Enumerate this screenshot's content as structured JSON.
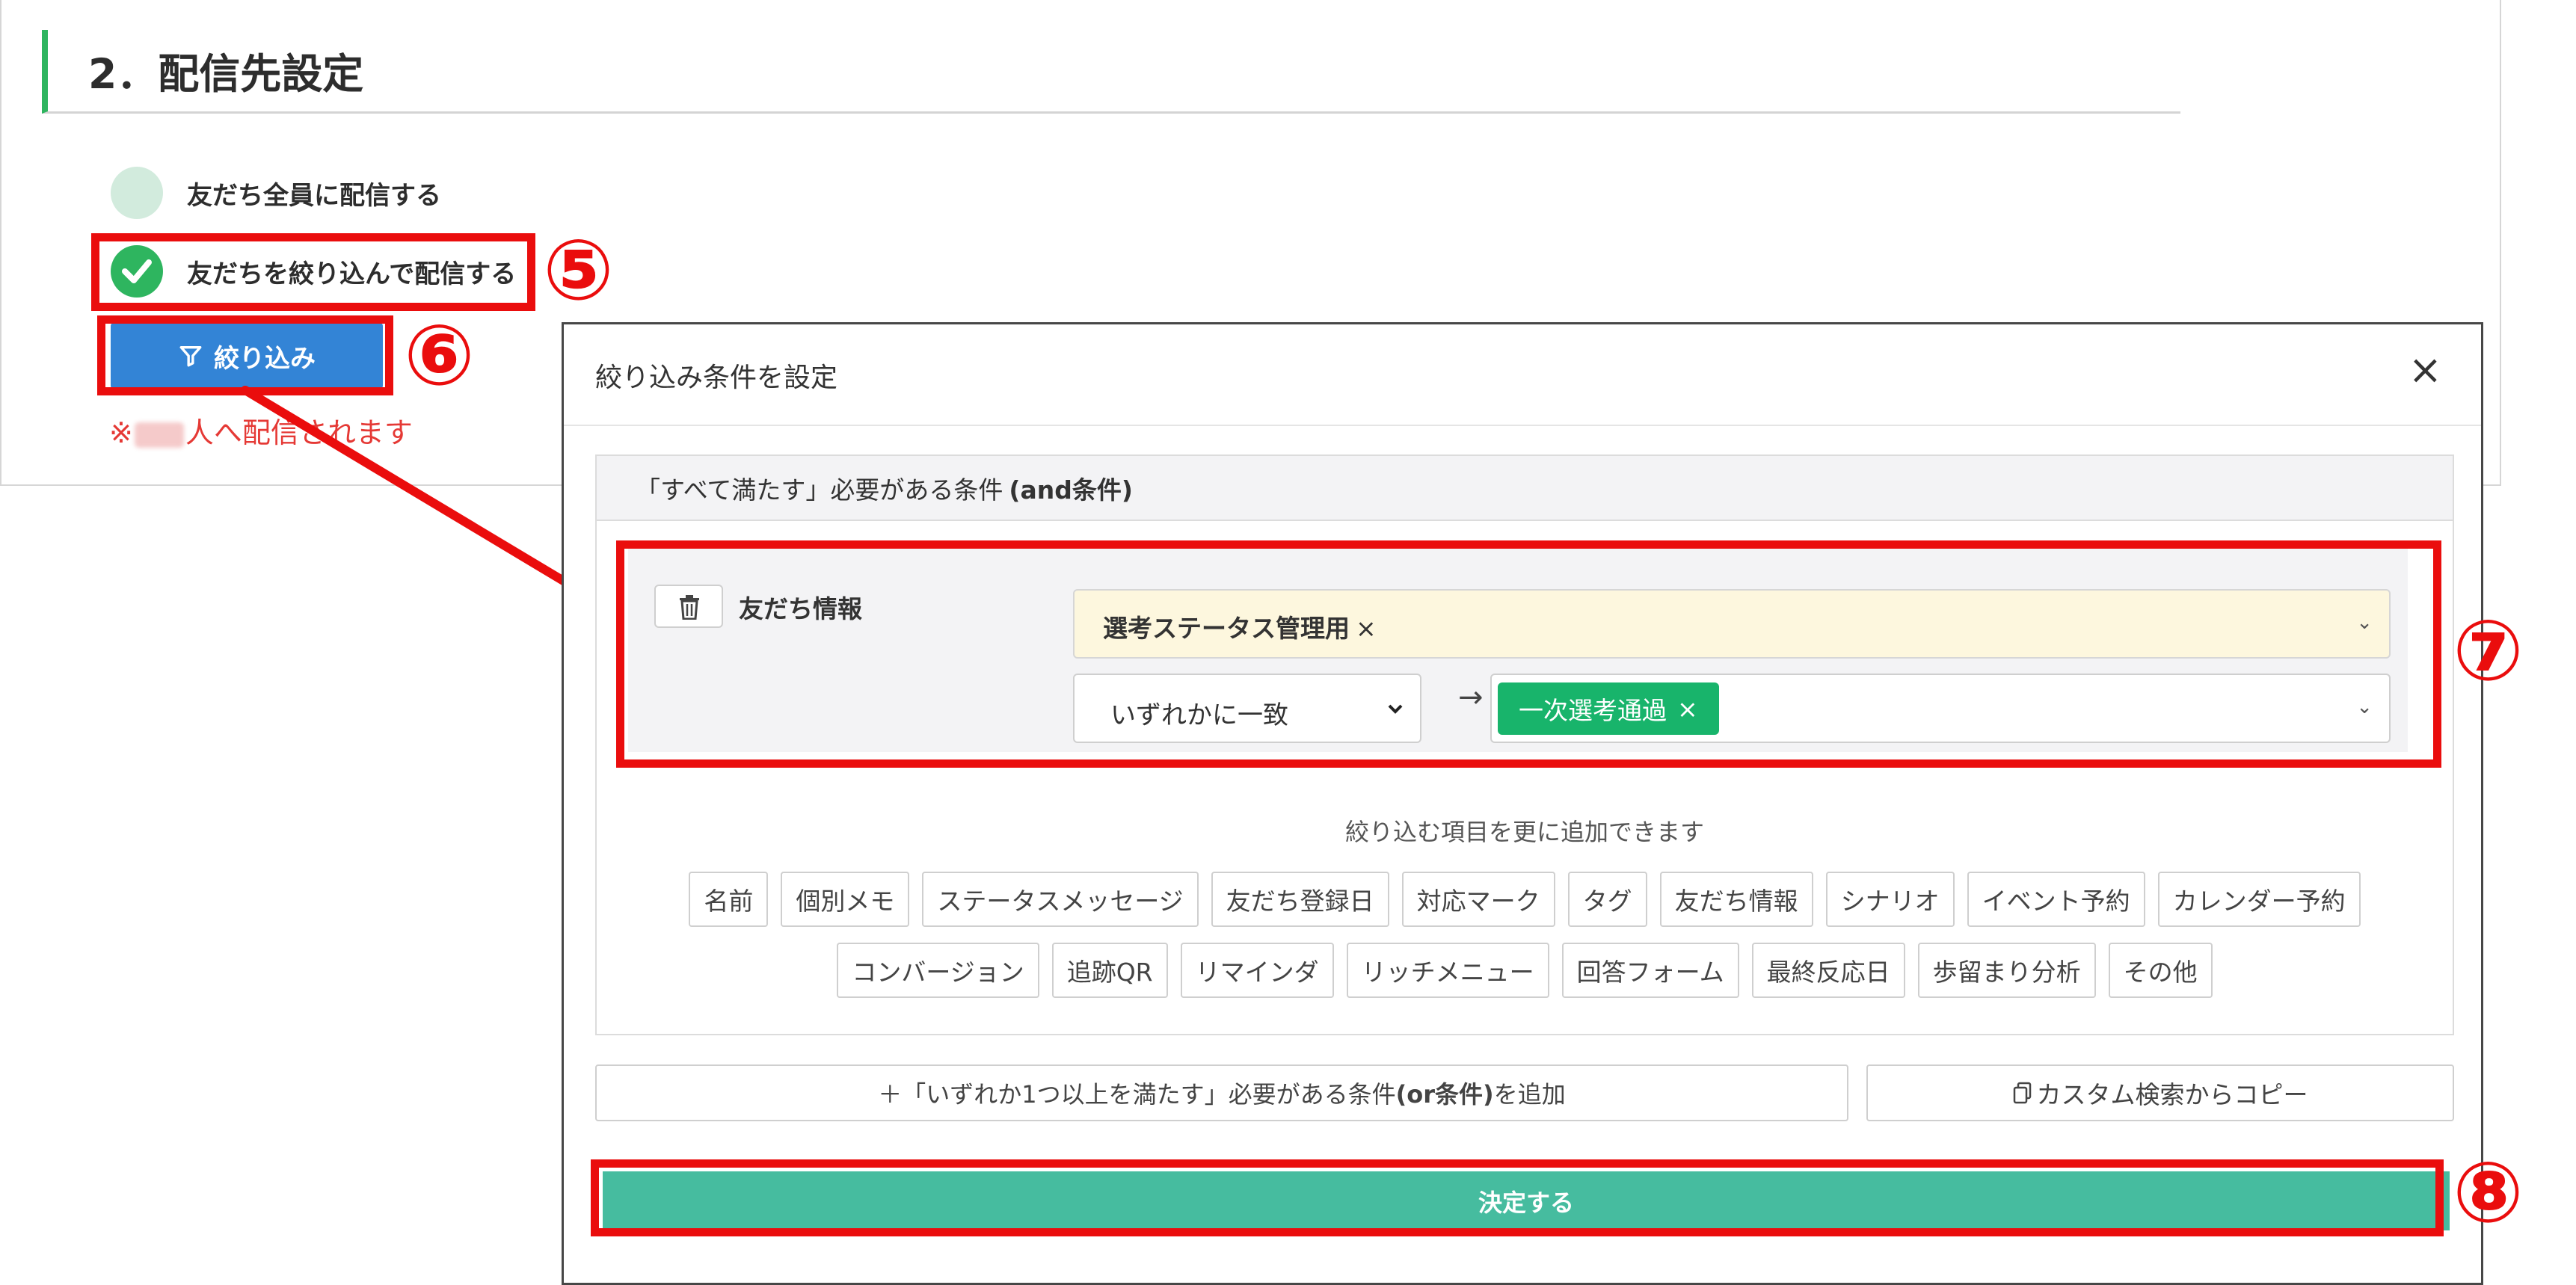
{
  "section": {
    "title": "2．配信先設定"
  },
  "radio": {
    "all_label": "友だち全員に配信する",
    "filter_label": "友だちを絞り込んで配信する"
  },
  "filter_button": {
    "label": "絞り込み"
  },
  "notice": {
    "prefix": "※",
    "suffix": "人へ配信されます"
  },
  "annotations": {
    "n5": "⑤",
    "n6": "⑥",
    "n7": "⑦",
    "n8": "⑧"
  },
  "modal": {
    "title": "絞り込み条件を設定",
    "close": "×",
    "and_header": "「すべて満たす」必要がある条件",
    "and_header_bold": "(and条件)",
    "condition": {
      "label": "友だち情報",
      "field_value": "選考ステータス管理用",
      "field_remove": "×",
      "match_mode": "いずれかに一致",
      "arrow": "→",
      "tag_value": "一次選考通過",
      "tag_remove": "×"
    },
    "hint": "絞り込む項目を更に追加できます",
    "chips_row1": [
      "名前",
      "個別メモ",
      "ステータスメッセージ",
      "友だち登録日",
      "対応マーク",
      "タグ",
      "友だち情報",
      "シナリオ",
      "イベント予約",
      "カレンダー予約"
    ],
    "chips_row2": [
      "コンバージョン",
      "追跡QR",
      "リマインダ",
      "リッチメニュー",
      "回答フォーム",
      "最終反応日",
      "歩留まり分析",
      "その他"
    ],
    "or_button_prefix": "＋「いずれか1つ以上を満たす」必要がある条件",
    "or_button_bold": "(or条件)",
    "or_button_suffix": "を追加",
    "copy_button": "カスタム検索からコピー",
    "submit": "決定する"
  },
  "colors": {
    "accent_green": "#2eb55f",
    "annotation_red": "#ea0d0d",
    "filter_blue": "#3384d6",
    "submit_teal": "#46bc9f"
  }
}
